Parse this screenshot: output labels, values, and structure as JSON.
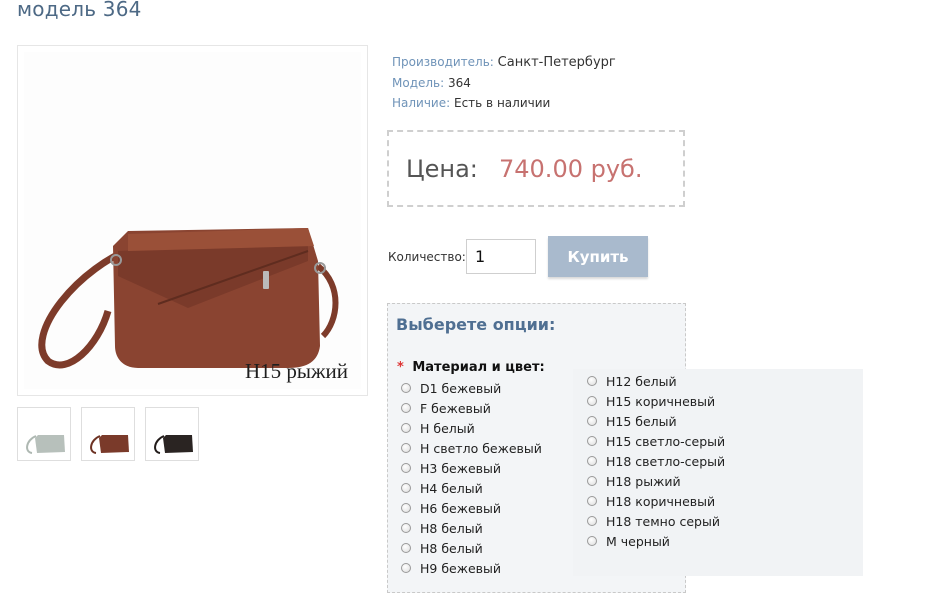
{
  "page": {
    "title": "модель 364"
  },
  "product": {
    "image_caption": "Н15 рыжий",
    "thumbnails": [
      {
        "name": "thumbnail-gray",
        "color": "#b7c0bb"
      },
      {
        "name": "thumbnail-brown",
        "color": "#7a3a2a"
      },
      {
        "name": "thumbnail-black",
        "color": "#2a2422"
      }
    ],
    "bag_color": "#8a4431"
  },
  "info": {
    "maker_label": "Производитель:",
    "maker_value": "Санкт-Петербург",
    "model_label": "Модель:",
    "model_value": "364",
    "stock_label": "Наличие:",
    "stock_value": "Есть в наличии"
  },
  "price": {
    "label": "Цена:",
    "value": "740.00 руб."
  },
  "purchase": {
    "qty_label": "Количество:",
    "qty_value": "1",
    "buy_label": "Купить"
  },
  "options": {
    "title": "Выберете опции:",
    "required_mark": "*",
    "material_label": "Материал и цвет:",
    "column1": [
      "D1 бежевый",
      "F бежевый",
      "H белый",
      "H светло бежевый",
      "H3 бежевый",
      "H4 белый",
      "H6 бежевый",
      "H8 белый",
      "H8 белый",
      "H9 бежевый"
    ],
    "column2": [
      "H12 белый",
      "H15 коричневый",
      "H15 белый",
      "H15 светло-серый",
      "H18 светло-серый",
      "H18 рыжий",
      "H18 коричневый",
      "H18 темно серый",
      "M черный"
    ]
  },
  "colors": {
    "accent": "#4d6985",
    "label": "#6f93b8",
    "price": "#c77270",
    "button": "#a9bacd"
  }
}
